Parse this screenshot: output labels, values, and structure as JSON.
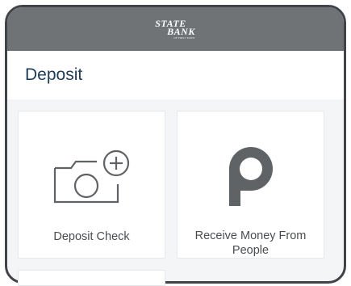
{
  "header": {
    "logo_line1": "STATE",
    "logo_line2": "BANK",
    "logo_tagline": "OF FIRST TOWN"
  },
  "page": {
    "title": "Deposit"
  },
  "tiles": [
    {
      "label": "Deposit Check",
      "icon": "camera-plus-icon"
    },
    {
      "label": "Receive Money From People",
      "icon": "p2p-logo-icon"
    }
  ],
  "colors": {
    "header_bg": "#6f7376",
    "title_text": "#1c3c5a",
    "icon_gray": "#606366"
  }
}
